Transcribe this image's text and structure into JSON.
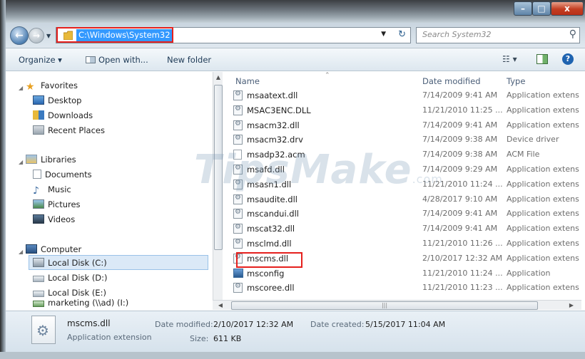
{
  "titlebar": {
    "minimize": "–",
    "maximize": "□",
    "close": "x"
  },
  "address": {
    "path": "C:\\Windows\\System32",
    "search_placeholder": "Search System32"
  },
  "toolbar": {
    "organize": "Organize ▾",
    "open_with": "Open with...",
    "new_folder": "New folder"
  },
  "nav": {
    "favorites": "Favorites",
    "desktop": "Desktop",
    "downloads": "Downloads",
    "recent": "Recent Places",
    "libraries": "Libraries",
    "documents": "Documents",
    "music": "Music",
    "pictures": "Pictures",
    "videos": "Videos",
    "computer": "Computer",
    "disk_c": "Local Disk (C:)",
    "disk_d": "Local Disk (D:)",
    "disk_e": "Local Disk (E:)",
    "marketing": "marketing (\\\\ad) (I:)"
  },
  "columns": {
    "name": "Name",
    "date": "Date modified",
    "type": "Type"
  },
  "files": [
    {
      "name": "msaatext.dll",
      "date": "7/14/2009 9:41 AM",
      "type": "Application extens",
      "icon": "dll-icon"
    },
    {
      "name": "MSAC3ENC.DLL",
      "date": "11/21/2010 11:25 ...",
      "type": "Application extens",
      "icon": "dll-icon"
    },
    {
      "name": "msacm32.dll",
      "date": "7/14/2009 9:41 AM",
      "type": "Application extens",
      "icon": "dll-icon"
    },
    {
      "name": "msacm32.drv",
      "date": "7/14/2009 9:38 AM",
      "type": "Device driver",
      "icon": "dll-icon"
    },
    {
      "name": "msadp32.acm",
      "date": "7/14/2009 9:38 AM",
      "type": "ACM File",
      "icon": "file-icon"
    },
    {
      "name": "msafd.dll",
      "date": "7/14/2009 9:29 AM",
      "type": "Application extens",
      "icon": "dll-icon"
    },
    {
      "name": "msasn1.dll",
      "date": "11/21/2010 11:24 ...",
      "type": "Application extens",
      "icon": "dll-icon"
    },
    {
      "name": "msaudite.dll",
      "date": "4/28/2017 9:10 AM",
      "type": "Application extens",
      "icon": "dll-icon"
    },
    {
      "name": "mscandui.dll",
      "date": "7/14/2009 9:41 AM",
      "type": "Application extens",
      "icon": "dll-icon"
    },
    {
      "name": "mscat32.dll",
      "date": "7/14/2009 9:41 AM",
      "type": "Application extens",
      "icon": "dll-icon"
    },
    {
      "name": "msclmd.dll",
      "date": "11/21/2010 11:26 ...",
      "type": "Application extens",
      "icon": "dll-icon"
    },
    {
      "name": "mscms.dll",
      "date": "2/10/2017 12:32 AM",
      "type": "Application extens",
      "icon": "dll-icon"
    },
    {
      "name": "msconfig",
      "date": "11/21/2010 11:24 ...",
      "type": "Application",
      "icon": "config-icon"
    },
    {
      "name": "mscoree.dll",
      "date": "11/21/2010 11:23 ...",
      "type": "Application extens",
      "icon": "dll-icon"
    }
  ],
  "details": {
    "name": "mscms.dll",
    "type": "Application extension",
    "modified_label": "Date modified:",
    "modified_value": "2/10/2017 12:32 AM",
    "created_label": "Date created:",
    "created_value": "5/15/2017 11:04 AM",
    "size_label": "Size:",
    "size_value": "611 KB"
  },
  "watermark": {
    "main": "TipsMake",
    "suffix": ".com"
  },
  "colors": {
    "selection": "#3399ff",
    "highlight_box": "#e5201d",
    "nav_selected": "#dbe9f7"
  }
}
